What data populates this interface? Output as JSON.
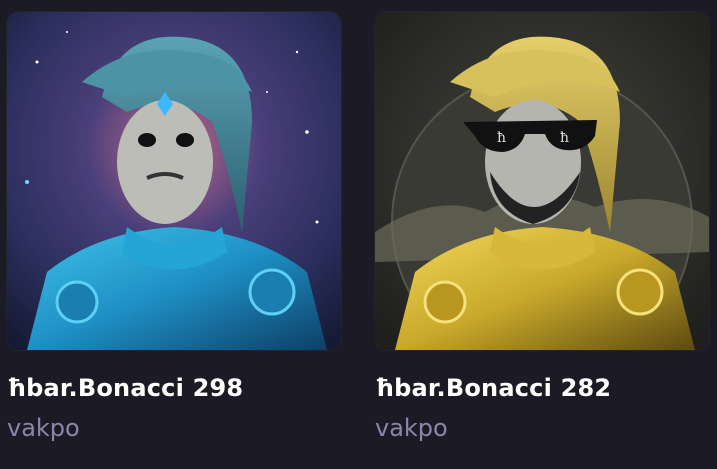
{
  "cards": [
    {
      "title": "ħbar.Bonacci 298",
      "creator": "vakpo",
      "theme": {
        "background_colors": [
          "#2b2f5e",
          "#4a3f7a",
          "#c26a8a",
          "#1a3a6a"
        ],
        "armor_color": "#1e8fc4",
        "hood_color": "#3c7f93",
        "accent": "gem"
      },
      "image_icon": "teal-knight-portrait"
    },
    {
      "title": "ħbar.Bonacci 282",
      "creator": "vakpo",
      "theme": {
        "background_colors": [
          "#2a2a2a",
          "#3e3a30",
          "#5a5a4a"
        ],
        "armor_color": "#c9a92a",
        "hood_color": "#cfb24a",
        "accent": "sunglasses"
      },
      "image_icon": "gold-knight-portrait"
    }
  ]
}
